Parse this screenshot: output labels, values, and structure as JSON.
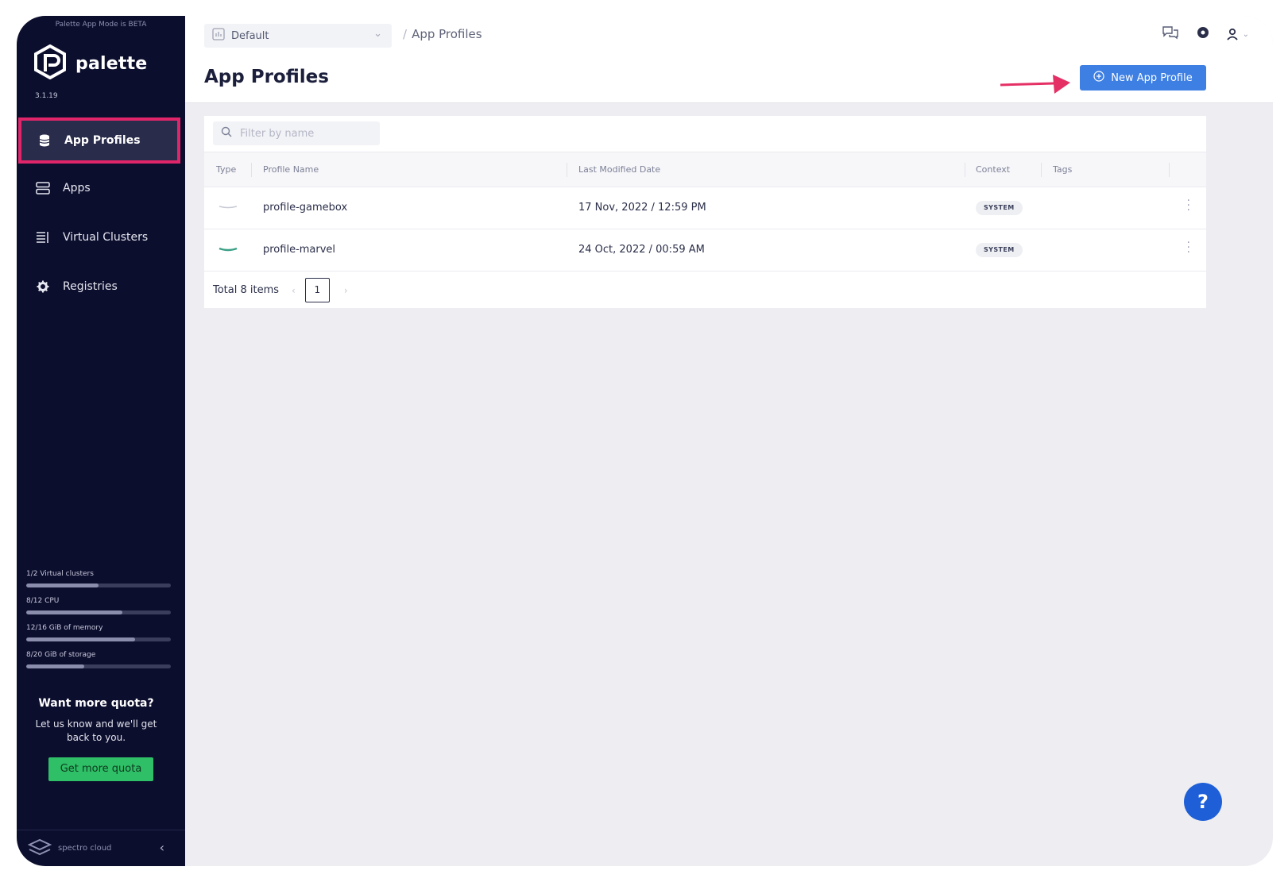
{
  "sidebar": {
    "beta_note": "Palette App Mode is BETA",
    "logo_name": "palette",
    "version": "3.1.19",
    "items": [
      {
        "label": "App Profiles",
        "icon": "database-icon",
        "active": true
      },
      {
        "label": "Apps",
        "icon": "server-icon",
        "active": false
      },
      {
        "label": "Virtual Clusters",
        "icon": "clusters-icon",
        "active": false
      },
      {
        "label": "Registries",
        "icon": "gear-icon",
        "active": false
      }
    ],
    "usage": [
      {
        "label": "1/2 Virtual clusters",
        "fraction": 0.5
      },
      {
        "label": "8/12 CPU",
        "fraction": 0.667
      },
      {
        "label": "12/16 GiB of memory",
        "fraction": 0.75
      },
      {
        "label": "8/20 GiB of storage",
        "fraction": 0.4
      }
    ],
    "quota": {
      "title": "Want more quota?",
      "text": "Let us know and we'll get back to you.",
      "button": "Get more quota"
    },
    "footer": {
      "brand": "spectro cloud"
    }
  },
  "topbar": {
    "project": "Default",
    "breadcrumb_sep": "/",
    "breadcrumb": "App Profiles",
    "title": "App Profiles",
    "new_button": "New App Profile"
  },
  "table": {
    "filter_placeholder": "Filter by name",
    "columns": [
      "Type",
      "Profile Name",
      "Last Modified Date",
      "Context",
      "Tags"
    ],
    "rows": [
      {
        "name": "profile-gamebox",
        "modified": "17 Nov, 2022 / 12:59 PM",
        "context": "SYSTEM"
      },
      {
        "name": "profile-marvel",
        "modified": "24 Oct, 2022 / 00:59 AM",
        "context": "SYSTEM"
      }
    ],
    "total": "Total 8 items",
    "page": "1"
  },
  "help": {
    "label": "?"
  },
  "colors": {
    "accent": "#3d7fe3",
    "highlight": "#e0256b",
    "sidebar": "#0c0e2d",
    "quota_button": "#2fbf67"
  }
}
